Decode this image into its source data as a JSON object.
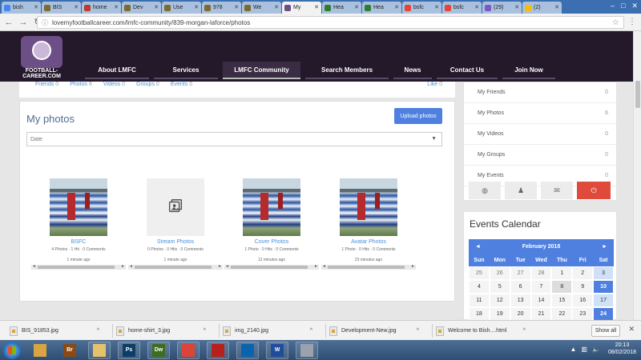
{
  "browser": {
    "tabs": [
      {
        "label": "bish",
        "color": "#4285f4"
      },
      {
        "label": "BIS",
        "color": "#7b6b2f"
      },
      {
        "label": "home",
        "color": "#c0392b"
      },
      {
        "label": "Dev",
        "color": "#7b6b2f"
      },
      {
        "label": "Use",
        "color": "#7b6b2f"
      },
      {
        "label": "978",
        "color": "#7b6b2f"
      },
      {
        "label": "We",
        "color": "#7b6b2f"
      },
      {
        "label": "My",
        "color": "#6c4f86"
      },
      {
        "label": "Hea",
        "color": "#2e7d32"
      },
      {
        "label": "Hea",
        "color": "#2e7d32"
      },
      {
        "label": "bsfc",
        "color": "#ea4335"
      },
      {
        "label": "bsfc",
        "color": "#ea4335"
      },
      {
        "label": "(29)",
        "color": "#7e57c2"
      },
      {
        "label": "(2)",
        "color": "#fbbc05"
      }
    ],
    "url": "lovemyfootballcareer.com/lmfc-community/839-morgan-laforce/photos"
  },
  "site": {
    "logo_text": "FOOTBALL-CAREER.COM",
    "nav": [
      "About LMFC",
      "Services",
      "LMFC Community",
      "Search Members",
      "News",
      "Contact Us",
      "Join Now"
    ]
  },
  "profile_stats": [
    {
      "label": "Friends",
      "count": "0"
    },
    {
      "label": "Photos",
      "count": "6"
    },
    {
      "label": "Videos",
      "count": "0"
    },
    {
      "label": "Groups",
      "count": "0"
    },
    {
      "label": "Events",
      "count": "0"
    }
  ],
  "likes": {
    "label": "Like",
    "count": "0"
  },
  "photos": {
    "title": "My photos",
    "upload_label": "Upload photos",
    "sort_selected": "Date",
    "albums": [
      {
        "name": "BSFC",
        "meta": "4 Photos · 1 Hit · 0 Comments",
        "time": "1 minute ago",
        "thumb": "team"
      },
      {
        "name": "Stream Photos",
        "meta": "0 Photos · 0 Hits · 0 Comments",
        "time": "1 minute ago",
        "thumb": "placeholder"
      },
      {
        "name": "Cover Photos",
        "meta": "1 Photo · 0 Hits · 0 Comments",
        "time": "12 minutes ago",
        "thumb": "team"
      },
      {
        "name": "Avatar Photos",
        "meta": "1 Photo · 0 Hits · 0 Comments",
        "time": "23 minutes ago",
        "thumb": "team"
      }
    ]
  },
  "sidebar": {
    "items": [
      {
        "label": "My Friends",
        "count": "0"
      },
      {
        "label": "My Photos",
        "count": "6"
      },
      {
        "label": "My Videos",
        "count": "0"
      },
      {
        "label": "My Groups",
        "count": "0"
      },
      {
        "label": "My Events",
        "count": "0"
      }
    ],
    "icons": [
      "globe-icon",
      "user-icon",
      "mail-icon",
      "power-icon"
    ]
  },
  "calendar": {
    "title": "Events Calendar",
    "month": "February 2018",
    "prev": "◄",
    "next": "►",
    "weekdays": [
      "Sun",
      "Mon",
      "Tue",
      "Wed",
      "Thu",
      "Fri",
      "Sat"
    ],
    "days": [
      {
        "d": "25",
        "c": "other"
      },
      {
        "d": "26",
        "c": "other"
      },
      {
        "d": "27",
        "c": "other"
      },
      {
        "d": "28",
        "c": "other"
      },
      {
        "d": "1",
        "c": ""
      },
      {
        "d": "2",
        "c": ""
      },
      {
        "d": "3",
        "c": "sat"
      },
      {
        "d": "4",
        "c": ""
      },
      {
        "d": "5",
        "c": ""
      },
      {
        "d": "6",
        "c": ""
      },
      {
        "d": "7",
        "c": ""
      },
      {
        "d": "8",
        "c": "today"
      },
      {
        "d": "9",
        "c": ""
      },
      {
        "d": "10",
        "c": "event"
      },
      {
        "d": "11",
        "c": ""
      },
      {
        "d": "12",
        "c": ""
      },
      {
        "d": "13",
        "c": ""
      },
      {
        "d": "14",
        "c": ""
      },
      {
        "d": "15",
        "c": ""
      },
      {
        "d": "16",
        "c": ""
      },
      {
        "d": "17",
        "c": "sat"
      },
      {
        "d": "18",
        "c": ""
      },
      {
        "d": "19",
        "c": ""
      },
      {
        "d": "20",
        "c": ""
      },
      {
        "d": "21",
        "c": ""
      },
      {
        "d": "22",
        "c": ""
      },
      {
        "d": "23",
        "c": ""
      },
      {
        "d": "24",
        "c": "event"
      }
    ]
  },
  "downloads": {
    "items": [
      "BIS_91853.jpg",
      "home-shirt_3.jpg",
      "img_2140.jpg",
      "Development-New.jpg",
      "Welcome to Bish....html"
    ],
    "show_all": "Show all"
  },
  "taskbar": {
    "apps": [
      {
        "label": "",
        "name": "explorer-app",
        "color": "#d9a441"
      },
      {
        "label": "Br",
        "name": "bridge-app",
        "color": "#8c4a12"
      },
      {
        "label": "",
        "name": "folder-app",
        "color": "#e6c36a"
      },
      {
        "label": "Ps",
        "name": "photoshop-app",
        "color": "#0b3d66"
      },
      {
        "label": "Dw",
        "name": "dreamweaver-app",
        "color": "#3c6e1f"
      },
      {
        "label": "",
        "name": "chrome-app",
        "color": "#db4437"
      },
      {
        "label": "",
        "name": "filezilla-app",
        "color": "#b8201b"
      },
      {
        "label": "",
        "name": "outlook-app",
        "color": "#0a64ad"
      },
      {
        "label": "W",
        "name": "word-app",
        "color": "#1e4d9b"
      },
      {
        "label": "",
        "name": "tools-app",
        "color": "#9aa3ad"
      }
    ],
    "time": "20:13",
    "date": "08/02/2018"
  }
}
